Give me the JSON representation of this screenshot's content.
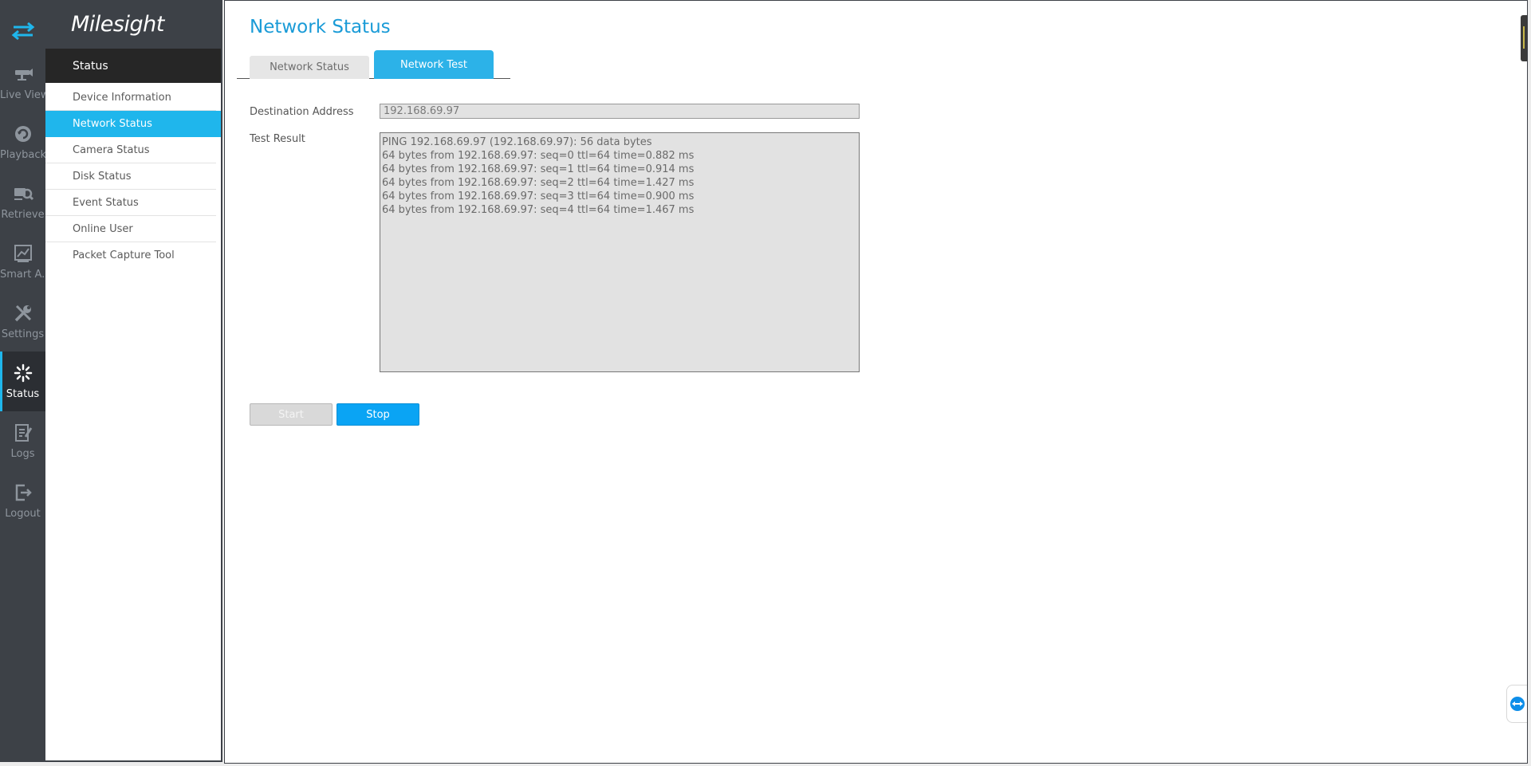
{
  "app": {
    "brand": "Milesight"
  },
  "rail": {
    "items": [
      {
        "id": "live-view",
        "label": "Live View",
        "icon": "live-view-icon"
      },
      {
        "id": "playback",
        "label": "Playback",
        "icon": "playback-icon"
      },
      {
        "id": "retrieve",
        "label": "Retrieve",
        "icon": "retrieve-icon"
      },
      {
        "id": "smart-analysis",
        "label": "Smart A...",
        "icon": "smart-analysis-icon"
      },
      {
        "id": "settings",
        "label": "Settings",
        "icon": "settings-icon"
      },
      {
        "id": "status",
        "label": "Status",
        "icon": "status-icon",
        "active": true
      },
      {
        "id": "logs",
        "label": "Logs",
        "icon": "logs-icon"
      },
      {
        "id": "logout",
        "label": "Logout",
        "icon": "logout-icon"
      }
    ]
  },
  "menu": {
    "header": "Status",
    "items": [
      {
        "label": "Device Information"
      },
      {
        "label": "Network Status",
        "active": true
      },
      {
        "label": "Camera Status"
      },
      {
        "label": "Disk Status"
      },
      {
        "label": "Event Status"
      },
      {
        "label": "Online User"
      },
      {
        "label": "Packet Capture Tool"
      }
    ]
  },
  "main": {
    "title": "Network Status",
    "tabs": [
      {
        "label": "Network Status",
        "active": false
      },
      {
        "label": "Network Test",
        "active": true
      }
    ],
    "destination_label": "Destination Address",
    "destination_value": "192.168.69.97",
    "result_label": "Test Result",
    "result_lines": [
      "PING 192.168.69.97 (192.168.69.97): 56 data bytes",
      "64 bytes from 192.168.69.97: seq=0 ttl=64 time=0.882 ms",
      "64 bytes from 192.168.69.97: seq=1 ttl=64 time=0.914 ms",
      "64 bytes from 192.168.69.97: seq=2 ttl=64 time=1.427 ms",
      "64 bytes from 192.168.69.97: seq=3 ttl=64 time=0.900 ms",
      "64 bytes from 192.168.69.97: seq=4 ttl=64 time=1.467 ms"
    ],
    "start_label": "Start",
    "stop_label": "Stop"
  },
  "colors": {
    "accent": "#1fb6ec",
    "title": "#1a9bd7",
    "button_primary": "#0aa4f4",
    "rail_bg": "#3d4147"
  }
}
